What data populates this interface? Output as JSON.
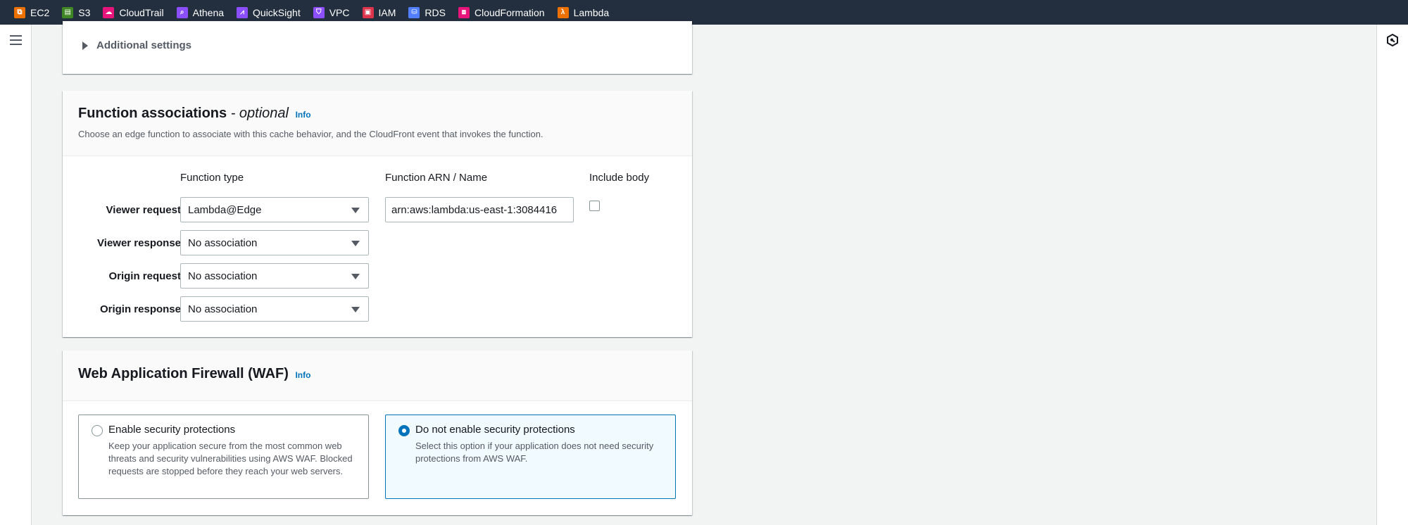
{
  "topnav": {
    "favorites": [
      {
        "label": "EC2",
        "icon": "ec2-icon",
        "color": "#ed7100"
      },
      {
        "label": "S3",
        "icon": "s3-icon",
        "color": "#3f8624"
      },
      {
        "label": "CloudTrail",
        "icon": "cloudtrail-icon",
        "color": "#e7157b"
      },
      {
        "label": "Athena",
        "icon": "athena-icon",
        "color": "#8c4fff"
      },
      {
        "label": "QuickSight",
        "icon": "quicksight-icon",
        "color": "#8c4fff"
      },
      {
        "label": "VPC",
        "icon": "vpc-icon",
        "color": "#8c4fff"
      },
      {
        "label": "IAM",
        "icon": "iam-icon",
        "color": "#dd344c"
      },
      {
        "label": "RDS",
        "icon": "rds-icon",
        "color": "#527fff"
      },
      {
        "label": "CloudFormation",
        "icon": "cloudformation-icon",
        "color": "#e7157b"
      },
      {
        "label": "Lambda",
        "icon": "lambda-icon",
        "color": "#ed7100"
      }
    ]
  },
  "additional_settings": {
    "label": "Additional settings"
  },
  "function_associations": {
    "title": "Function associations",
    "title_suffix": " - optional",
    "info": "Info",
    "description": "Choose an edge function to associate with this cache behavior, and the CloudFront event that invokes the function.",
    "columns": {
      "function_type": "Function type",
      "function_arn": "Function ARN / Name",
      "include_body": "Include body"
    },
    "rows": [
      {
        "label": "Viewer request",
        "function_type": "Lambda@Edge",
        "arn": "arn:aws:lambda:us-east-1:3084416",
        "include_body": false
      },
      {
        "label": "Viewer response",
        "function_type": "No association"
      },
      {
        "label": "Origin request",
        "function_type": "No association"
      },
      {
        "label": "Origin response",
        "function_type": "No association"
      }
    ]
  },
  "waf": {
    "title": "Web Application Firewall (WAF)",
    "info": "Info",
    "options": [
      {
        "label": "Enable security protections",
        "description": "Keep your application secure from the most common web threats and security vulnerabilities using AWS WAF. Blocked requests are stopped before they reach your web servers.",
        "selected": false
      },
      {
        "label": "Do not enable security protections",
        "description": "Select this option if your application does not need security protections from AWS WAF.",
        "selected": true
      }
    ]
  },
  "colors": {
    "nav_bg": "#232f3e",
    "link": "#0073bb",
    "selected_tile_bg": "#f1faff"
  }
}
